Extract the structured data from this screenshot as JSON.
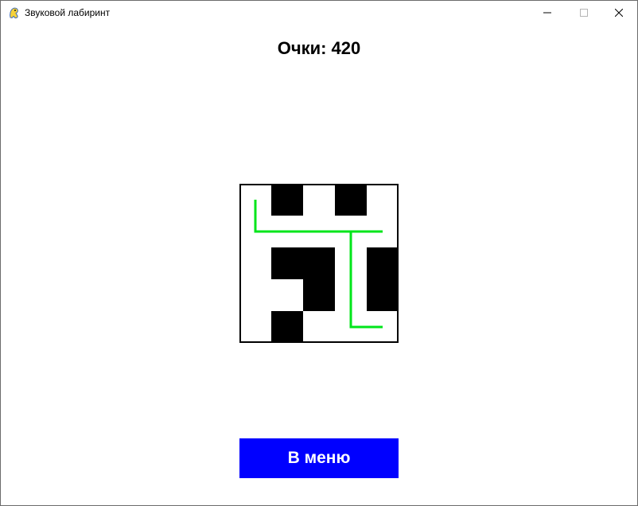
{
  "window": {
    "title": "Звуковой лабиринт",
    "controls": [
      "minimize-icon",
      "maximize-icon",
      "close-icon"
    ]
  },
  "score": {
    "text": "Очки: 420"
  },
  "maze": {
    "rows": 5,
    "cols": 5,
    "walls": [
      [
        0,
        1
      ],
      [
        0,
        3
      ],
      [
        2,
        1
      ],
      [
        2,
        2
      ],
      [
        2,
        4
      ],
      [
        3,
        2
      ],
      [
        3,
        4
      ],
      [
        4,
        1
      ]
    ],
    "path": [
      [
        0,
        0
      ],
      [
        1,
        0
      ],
      [
        1,
        1
      ],
      [
        1,
        2
      ],
      [
        1,
        3
      ],
      [
        1,
        4
      ],
      [
        1,
        3
      ],
      [
        2,
        3
      ],
      [
        3,
        3
      ],
      [
        4,
        3
      ],
      [
        4,
        4
      ]
    ],
    "wall_color": "#000000",
    "path_color": "#00e51a",
    "background_color": "#ffffff"
  },
  "menu_button": {
    "label": "В меню",
    "color": "#0000ff"
  }
}
